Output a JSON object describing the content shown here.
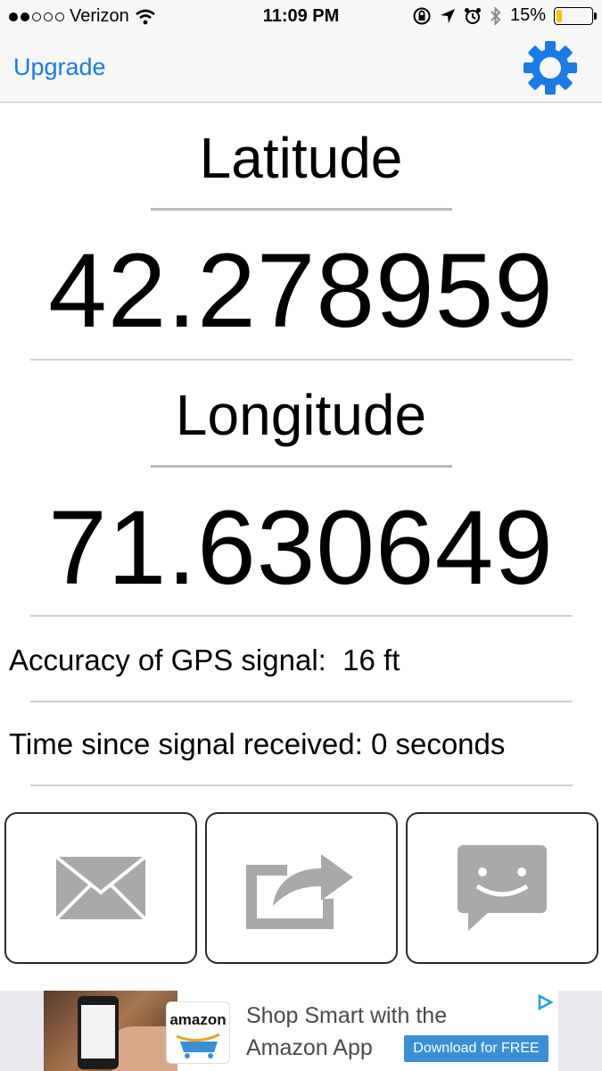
{
  "status_bar": {
    "carrier": "Verizon",
    "signal_bars_filled": 2,
    "signal_bars_total": 5,
    "time": "11:09 PM",
    "battery_percent_text": "15%",
    "battery_level": 0.15
  },
  "nav": {
    "upgrade_label": "Upgrade",
    "settings_icon": "gear-icon"
  },
  "main": {
    "latitude_label": "Latitude",
    "latitude_value": "42.278959",
    "longitude_label": "Longitude",
    "longitude_value": "71.630649",
    "accuracy_text": "Accuracy of GPS signal:  16 ft",
    "time_since_text": "Time since signal received: 0 seconds"
  },
  "actions": [
    {
      "icon": "envelope-icon"
    },
    {
      "icon": "share-icon"
    },
    {
      "icon": "message-icon"
    }
  ],
  "ad": {
    "brand": "amazon",
    "line1": "Shop Smart with the",
    "line2": "Amazon App",
    "cta": "Download for FREE"
  },
  "colors": {
    "accent": "#1a7ae6",
    "battery_fill": "#f6c400",
    "icon_gray": "#a9a9a9"
  }
}
